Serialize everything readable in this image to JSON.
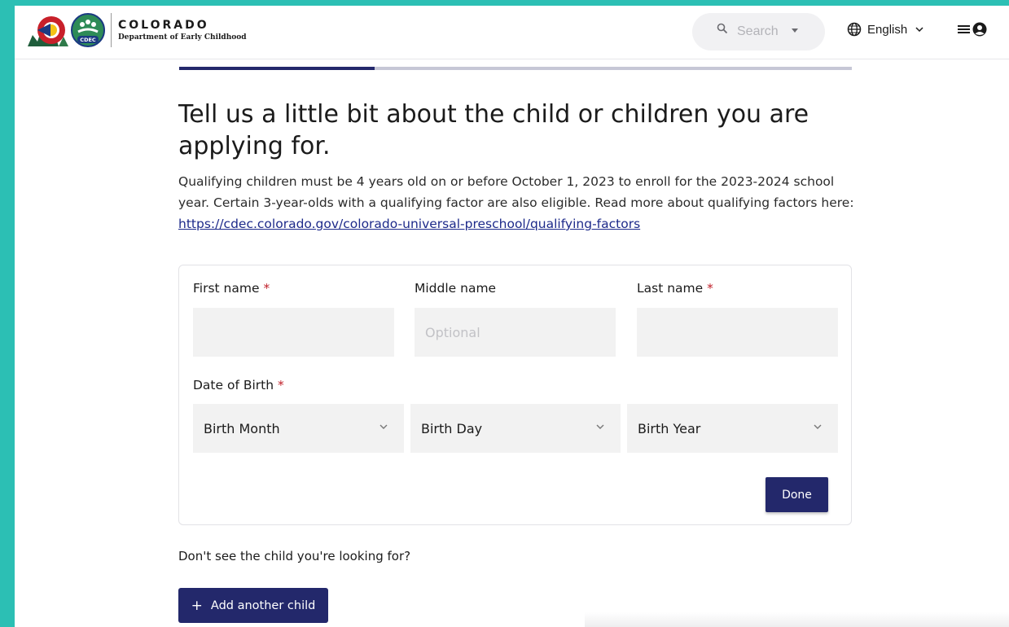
{
  "header": {
    "brand_title": "COLORADO",
    "brand_subtitle": "Department of Early Childhood",
    "badge_text": "CDEC",
    "search_placeholder": "Search",
    "language": "English"
  },
  "progress": {
    "fraction": 0.29
  },
  "page": {
    "heading": "Tell us a little bit about the child or children you are applying for.",
    "intro_text": "Qualifying children must be 4 years old on or before October 1, 2023 to enroll for the 2023-2024 school year. Certain 3-year-olds with a qualifying factor are also eligible. Read more about qualifying factors here: ",
    "intro_link": "https://cdec.colorado.gov/colorado-universal-preschool/qualifying-factors"
  },
  "form": {
    "first_name_label": "First name",
    "middle_name_label": "Middle name",
    "middle_name_placeholder": "Optional",
    "last_name_label": "Last name",
    "required_marker": "*",
    "dob_label": "Date of Birth",
    "birth_month": "Birth Month",
    "birth_day": "Birth Day",
    "birth_year": "Birth Year",
    "done_label": "Done"
  },
  "footer": {
    "notice": "Don't see the child you're looking for?",
    "add_label": "Add another child",
    "add_icon": "+"
  },
  "colors": {
    "accent": "#23286b",
    "frame": "#2cbfb4",
    "required": "#c0202a",
    "link": "#1d2a8a"
  }
}
